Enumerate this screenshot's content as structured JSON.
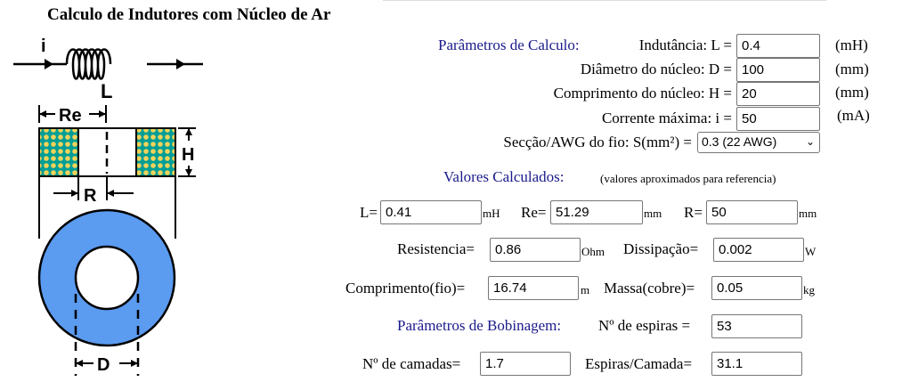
{
  "title": "Calculo de Indutores com Núcleo de Ar",
  "diagram": {
    "coil_current": "i",
    "coil_label": "L",
    "re_label": "Re",
    "h_label": "H",
    "r_label": "R",
    "d_label": "D"
  },
  "params": {
    "heading": "Parâmetros de Calculo:",
    "inductance": {
      "label": "Indutância: L =",
      "value": "0.4",
      "unit": "(mH)"
    },
    "diameter": {
      "label": "Diâmetro do núcleo: D =",
      "value": "100",
      "unit": "(mm)"
    },
    "length": {
      "label": "Comprimento do núcleo: H =",
      "value": "20",
      "unit": "(mm)"
    },
    "current": {
      "label": "Corrente máxima: i =",
      "value": "50",
      "unit": "(mA)"
    },
    "wire": {
      "label": "Secção/AWG do fio: S(mm²) =",
      "selected": "0.3 (22 AWG)"
    }
  },
  "results": {
    "heading": "Valores Calculados:",
    "note": "(valores aproximados para referencia)",
    "L": {
      "label": "L=",
      "value": "0.41",
      "unit": "mH"
    },
    "Re": {
      "label": "Re=",
      "value": "51.29",
      "unit": "mm"
    },
    "R": {
      "label": "R=",
      "value": "50",
      "unit": "mm"
    },
    "resistance": {
      "label": "Resistencia=",
      "value": "0.86",
      "unit": "Ohm"
    },
    "dissipation": {
      "label": "Dissipação=",
      "value": "0.002",
      "unit": "W"
    },
    "wire_length": {
      "label": "Comprimento(fio)=",
      "value": "16.74",
      "unit": "m"
    },
    "mass": {
      "label": "Massa(cobre)=",
      "value": "0.05",
      "unit": "kg"
    }
  },
  "winding": {
    "heading": "Parâmetros de Bobinagem:",
    "turns": {
      "label": "Nº de espiras =",
      "value": "53"
    },
    "layers": {
      "label": "Nº de camadas=",
      "value": "1.7"
    },
    "turns_per_layer": {
      "label": "Espiras/Camada=",
      "value": "31.1"
    }
  },
  "colors": {
    "ring": "#5b9bf0",
    "winding_green": "#009e96",
    "winding_dot": "#f2d25a",
    "heading_blue": "#1a1a8c"
  }
}
